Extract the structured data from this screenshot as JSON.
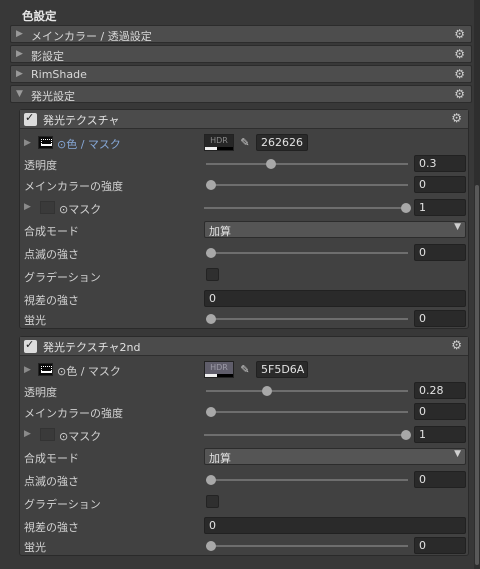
{
  "section_title": "色設定",
  "folds": [
    {
      "label": "メインカラー / 透過設定",
      "arrow": "▶"
    },
    {
      "label": "影設定",
      "arrow": "▶"
    },
    {
      "label": "RimShade",
      "arrow": "▶"
    },
    {
      "label": "発光設定",
      "arrow": "▼"
    }
  ],
  "gear_icon": "⚙",
  "eyedropper_icon": "✎",
  "sub_arrow": "▶",
  "panels": [
    {
      "title": "発光テクスチャ",
      "tex_label": "色 / マスク",
      "hex": "262626",
      "hdr": "HDR",
      "swatch_color": "#262626",
      "rows": {
        "opacity_label": "透明度",
        "opacity_value": "0.3",
        "opacity_level": 0.3,
        "main_strength_label": "メインカラーの強度",
        "main_strength_value": "0",
        "mask_label": "マスク",
        "mask_value": "1",
        "blend_label": "合成モード",
        "blend_value": "加算",
        "blink_label": "点滅の強さ",
        "blink_value": "0",
        "gradation_label": "グラデーション",
        "parallax_label": "視差の強さ",
        "parallax_value": "0",
        "fluor_label": "蛍光",
        "fluor_value": "0"
      }
    },
    {
      "title": "発光テクスチャ2nd",
      "tex_label": "色 / マスク",
      "hex": "5F5D6A",
      "hdr": "HDR",
      "swatch_color": "#5F5D6A",
      "rows": {
        "opacity_label": "透明度",
        "opacity_value": "0.28",
        "opacity_level": 0.28,
        "main_strength_label": "メインカラーの強度",
        "main_strength_value": "0",
        "mask_label": "マスク",
        "mask_value": "1",
        "blend_label": "合成モード",
        "blend_value": "加算",
        "blink_label": "点滅の強さ",
        "blink_value": "0",
        "gradation_label": "グラデーション",
        "parallax_label": "視差の強さ",
        "parallax_value": "0",
        "fluor_label": "蛍光",
        "fluor_value": "0"
      }
    }
  ],
  "dropdown_caret": "▼"
}
